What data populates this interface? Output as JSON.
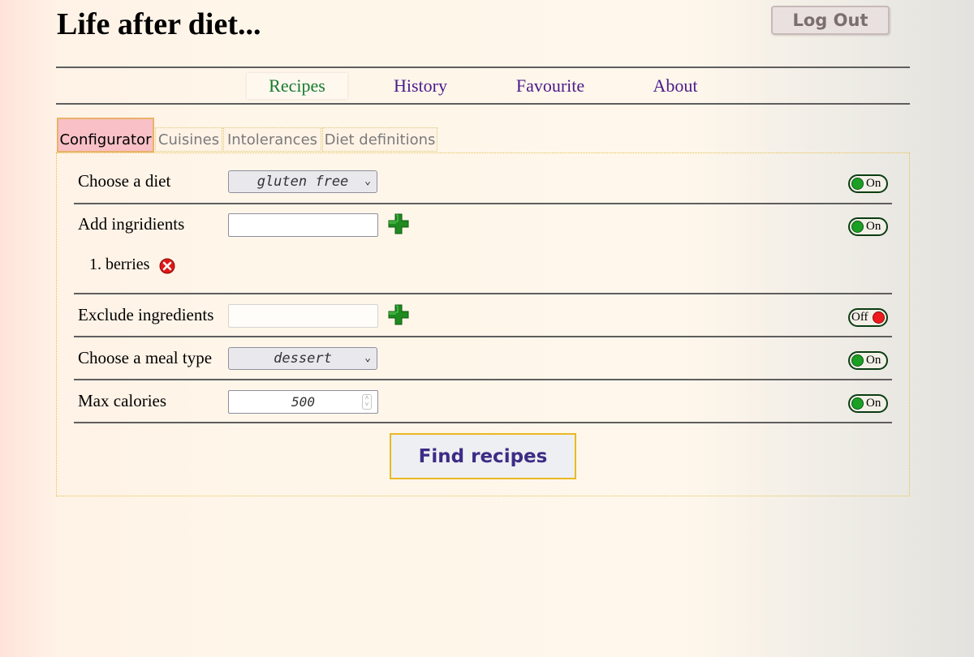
{
  "app_title": "Life after diet...",
  "logout_label": "Log Out",
  "nav": {
    "items": [
      {
        "label": "Recipes",
        "active": true
      },
      {
        "label": "History",
        "active": false
      },
      {
        "label": "Favourite",
        "active": false
      },
      {
        "label": "About",
        "active": false
      }
    ]
  },
  "tabs": [
    {
      "label": "Configurator",
      "active": true
    },
    {
      "label": "Cuisines",
      "active": false
    },
    {
      "label": "Intolerances",
      "active": false
    },
    {
      "label": "Diet definitions",
      "active": false
    }
  ],
  "configurator": {
    "diet": {
      "label": "Choose a diet",
      "value": "gluten free",
      "toggle": "On"
    },
    "add_ingredients": {
      "label": "Add ingridients",
      "value": "",
      "toggle": "On",
      "items": [
        "1. berries"
      ]
    },
    "exclude_ingredients": {
      "label": "Exclude ingredients",
      "value": "",
      "toggle": "Off"
    },
    "meal_type": {
      "label": "Choose a meal type",
      "value": "dessert",
      "toggle": "On"
    },
    "max_calories": {
      "label": "Max calories",
      "value": "500",
      "toggle": "On"
    }
  },
  "find_button_label": "Find recipes",
  "colors": {
    "toggle_on": "#1ba025",
    "toggle_off": "#ef1b1b",
    "add_icon": "#1f8a1f",
    "remove_icon": "#e01818",
    "active_tab": "#f9c0c7",
    "nav_active": "#147a2e",
    "nav_link": "#4b1a8b"
  },
  "icons": {
    "add": "plus-icon",
    "remove": "remove-circle-icon",
    "select": "chevron-down-icon"
  }
}
